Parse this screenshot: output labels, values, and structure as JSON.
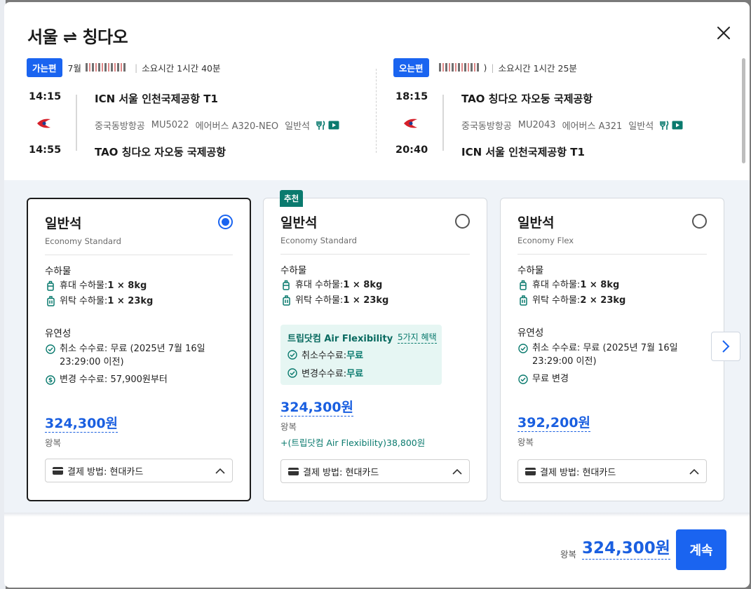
{
  "modal": {
    "title": "서울 ⇌ 칭다오",
    "close_label": "×"
  },
  "outbound": {
    "badge": "가는편",
    "date": "7월",
    "duration": "소요시간 1시간 40분",
    "depart_time": "14:15",
    "arrive_time": "14:55",
    "depart_airport": "ICN 서울 인천국제공항 T1",
    "arrive_airport": "TAO 칭다오 자오둥 국제공항",
    "airline": "중국동방항공",
    "flight_no": "MU5022",
    "aircraft": "에어버스 A320-NEO",
    "cabin": "일반석"
  },
  "return": {
    "badge": "오는편",
    "date_suffix": ")",
    "duration": "소요시간 1시간 25분",
    "depart_time": "18:15",
    "arrive_time": "20:40",
    "depart_airport": "TAO 칭다오 자오둥 국제공항",
    "arrive_airport": "ICN 서울 인천국제공항 T1",
    "airline": "중국동방항공",
    "flight_no": "MU2043",
    "aircraft": "에어버스 A321",
    "cabin": "일반석"
  },
  "fares": [
    {
      "name": "일반석",
      "subtitle": "Economy Standard",
      "selected": true,
      "baggage_title": "수하물",
      "carry_label": "휴대 수하물: ",
      "carry_value": "1 × 8kg",
      "checked_label": "위탁 수하물: ",
      "checked_value": "1 × 23kg",
      "flex_title": "유연성",
      "cancel_text": "취소 수수료: 무료 (2025년 7월 16일 23:29:00 이전)",
      "change_text": "변경 수수료: 57,900원부터",
      "price": "324,300원",
      "price_sub": "왕복",
      "payment": "결제 방법: 현대카드"
    },
    {
      "name": "일반석",
      "subtitle": "Economy Standard",
      "selected": false,
      "badge": "추천",
      "baggage_title": "수하물",
      "carry_label": "휴대 수하물: ",
      "carry_value": "1 × 8kg",
      "checked_label": "위탁 수하물: ",
      "checked_value": "1 × 23kg",
      "flex_box_title": "트립닷컴 Air Flexibility",
      "flex_box_link": "5가지 혜택",
      "flex_cancel_label": "취소수수료: ",
      "flex_cancel_value": "무료",
      "flex_change_label": "변경수수료: ",
      "flex_change_value": "무료",
      "price": "324,300원",
      "price_sub": "왕복",
      "addon": "+(트립닷컴 Air Flexibility)38,800원",
      "payment": "결제 방법: 현대카드"
    },
    {
      "name": "일반석",
      "subtitle": "Economy Flex",
      "selected": false,
      "baggage_title": "수하물",
      "carry_label": "휴대 수하물: ",
      "carry_value": "1 × 8kg",
      "checked_label": "위탁 수하물: ",
      "checked_value": "2 × 23kg",
      "flex_title": "유연성",
      "cancel_text": "취소 수수료: 무료 (2025년 7월 16일 23:29:00 이전)",
      "change_text": "무료 변경",
      "price": "392,200원",
      "price_sub": "왕복",
      "payment": "결제 방법: 현대카드"
    }
  ],
  "footer": {
    "total_label": "왕복",
    "total_price": "324,300원",
    "continue_label": "계속"
  },
  "colors": {
    "accent": "#1a64f0",
    "price": "#1a5fe0",
    "teal": "#0a7a6e"
  }
}
